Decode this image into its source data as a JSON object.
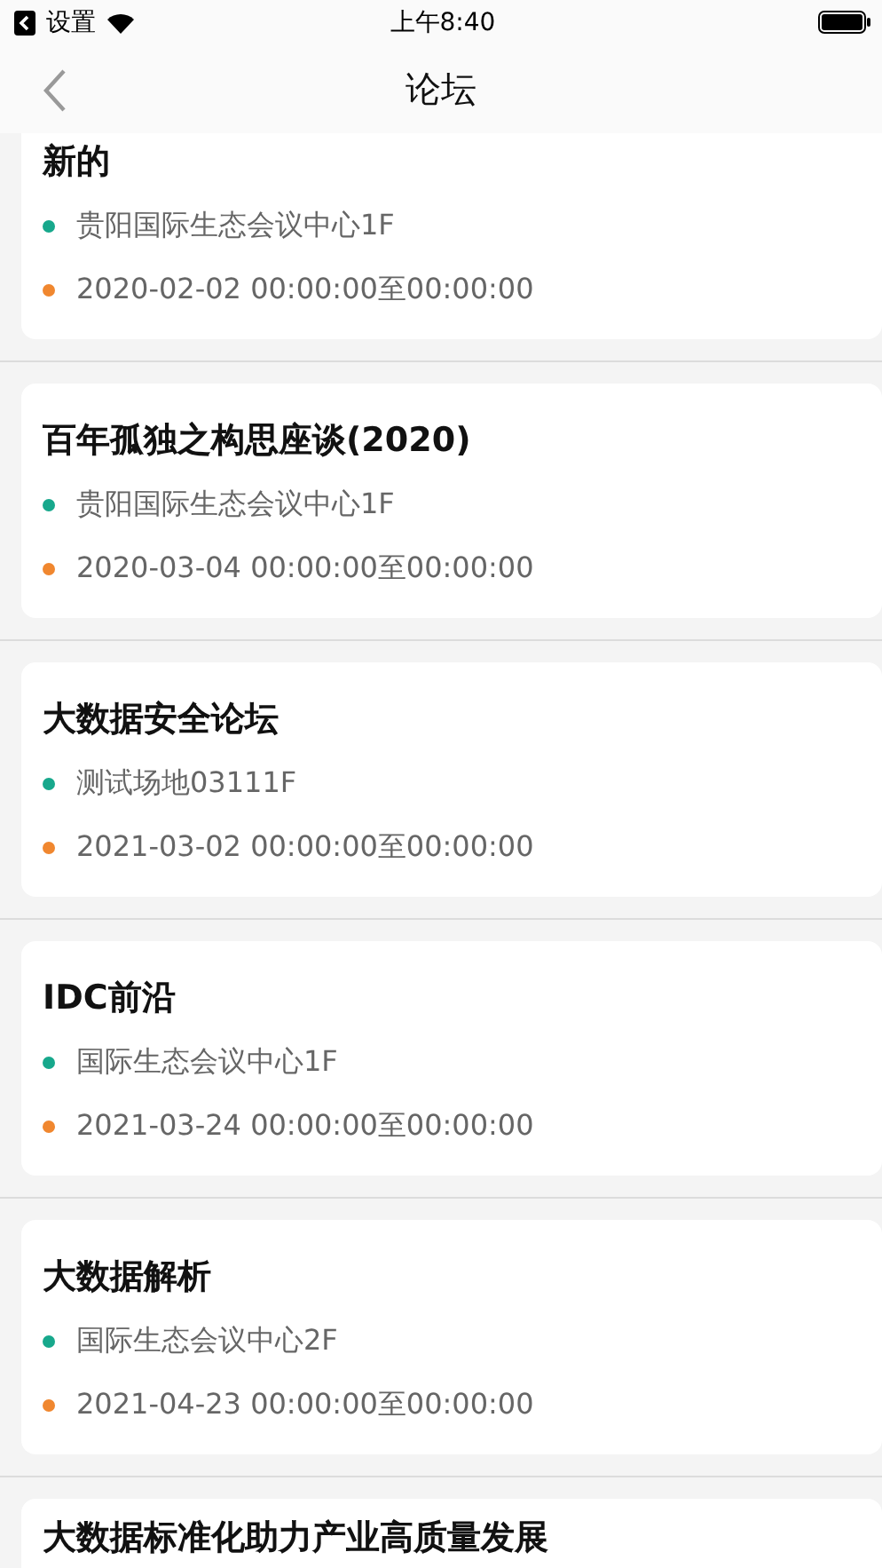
{
  "status_bar": {
    "back_app": "设置",
    "time": "上午8:40"
  },
  "nav": {
    "title": "论坛"
  },
  "forums": [
    {
      "title": "新的",
      "details": [
        {
          "kind": "location",
          "text": "贵阳国际生态会议中心1F"
        },
        {
          "kind": "time",
          "text": "2020-02-02 00:00:00至00:00:00"
        }
      ]
    },
    {
      "title": "百年孤独之构思座谈(2020)",
      "details": [
        {
          "kind": "location",
          "text": "贵阳国际生态会议中心1F"
        },
        {
          "kind": "time",
          "text": "2020-03-04 00:00:00至00:00:00"
        }
      ]
    },
    {
      "title": "大数据安全论坛",
      "details": [
        {
          "kind": "location",
          "text": "测试场地03111F"
        },
        {
          "kind": "time",
          "text": "2021-03-02 00:00:00至00:00:00"
        }
      ]
    },
    {
      "title": "IDC前沿",
      "details": [
        {
          "kind": "location",
          "text": "国际生态会议中心1F"
        },
        {
          "kind": "time",
          "text": "2021-03-24 00:00:00至00:00:00"
        }
      ]
    },
    {
      "title": "大数据解析",
      "details": [
        {
          "kind": "location",
          "text": "国际生态会议中心2F"
        },
        {
          "kind": "time",
          "text": "2021-04-23 00:00:00至00:00:00"
        }
      ]
    },
    {
      "title": "大数据标准化助力产业高质量发展"
    }
  ]
}
